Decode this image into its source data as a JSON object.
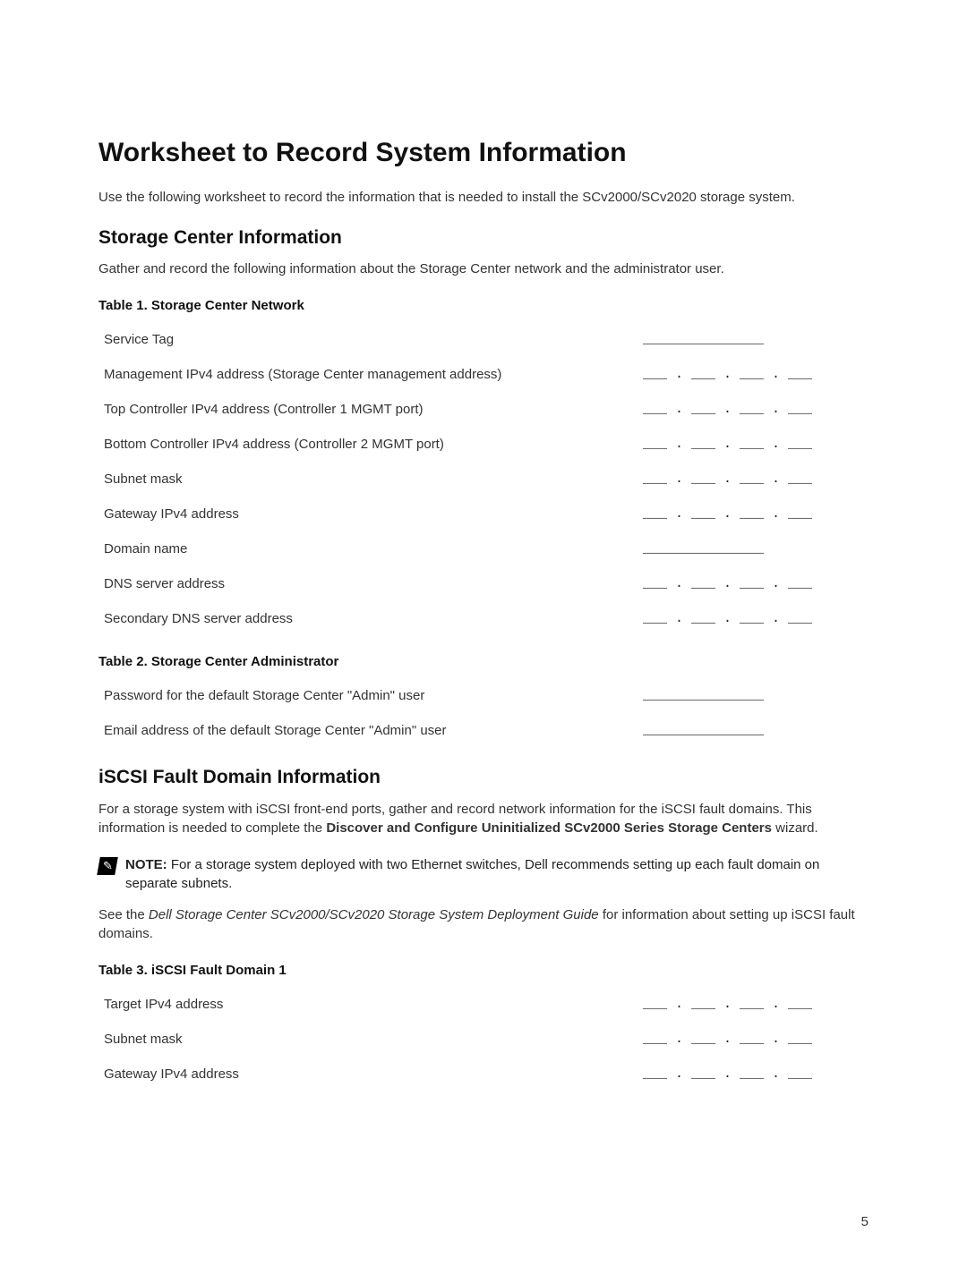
{
  "title": "Worksheet to Record System Information",
  "intro": "Use the following worksheet to record the information that is needed to install the SCv2000/SCv2020 storage system.",
  "section1": {
    "heading": "Storage Center Information",
    "intro": "Gather and record the following information about the Storage Center network and the administrator user."
  },
  "table1": {
    "caption": "Table 1. Storage Center Network",
    "rows": [
      {
        "label": "Service Tag",
        "blank": "_______________"
      },
      {
        "label": "Management IPv4 address (Storage Center management address)",
        "blank": "___ . ___ . ___ . ___"
      },
      {
        "label": "Top Controller IPv4 address (Controller 1 MGMT port)",
        "blank": "___ . ___ . ___ . ___"
      },
      {
        "label": "Bottom Controller IPv4 address (Controller 2 MGMT port)",
        "blank": "___ . ___ . ___ . ___"
      },
      {
        "label": "Subnet mask",
        "blank": "___ . ___ . ___ . ___"
      },
      {
        "label": "Gateway IPv4 address",
        "blank": "___ . ___ . ___ . ___"
      },
      {
        "label": "Domain name",
        "blank": "_______________"
      },
      {
        "label": "DNS server address",
        "blank": "___ . ___ . ___ . ___"
      },
      {
        "label": "Secondary DNS server address",
        "blank": "___ . ___ . ___ . ___"
      }
    ]
  },
  "table2": {
    "caption": "Table 2. Storage Center Administrator",
    "rows": [
      {
        "label": "Password for the default Storage Center \"Admin\" user",
        "blank": "_______________"
      },
      {
        "label": "Email address of the default Storage Center \"Admin\" user",
        "blank": "_______________"
      }
    ]
  },
  "section2": {
    "heading": "iSCSI Fault Domain Information",
    "intro_pre": "For a storage system with iSCSI front-end ports, gather and record network information for the iSCSI fault domains. This information is needed to complete the ",
    "intro_bold": "Discover and Configure Uninitialized SCv2000 Series Storage Centers",
    "intro_post": " wizard."
  },
  "note": {
    "label": "NOTE: ",
    "text": "For a storage system deployed with two Ethernet switches, Dell recommends setting up each fault domain on separate subnets."
  },
  "ref": {
    "pre": "See the ",
    "italic": "Dell Storage Center SCv2000/SCv2020 Storage System Deployment Guide",
    "post": " for information about setting up iSCSI fault domains."
  },
  "table3": {
    "caption": "Table 3. iSCSI Fault Domain 1",
    "rows": [
      {
        "label": "Target IPv4 address",
        "blank": "___ . ___ . ___ . ___"
      },
      {
        "label": "Subnet mask",
        "blank": "___ . ___ . ___ . ___"
      },
      {
        "label": "Gateway IPv4 address",
        "blank": "___ . ___ . ___ . ___"
      }
    ]
  },
  "page_number": "5"
}
